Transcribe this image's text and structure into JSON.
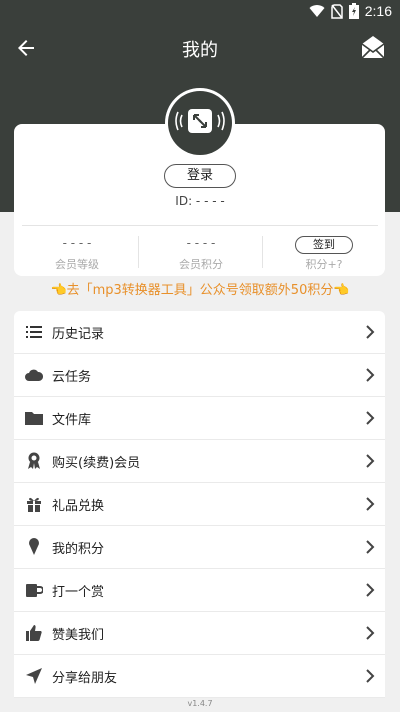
{
  "status_bar": {
    "time": "2:16"
  },
  "header": {
    "title": "我的"
  },
  "profile": {
    "login_label": "登录",
    "user_id": "ID: - - - -",
    "stats": [
      {
        "value": "- - - -",
        "label": "会员等级"
      },
      {
        "value": "- - - -",
        "label": "会员积分"
      }
    ],
    "checkin_label": "签到",
    "checkin_points": "积分+?"
  },
  "promo_text": "👈去「mp3转换器工具」公众号领取额外50积分👈",
  "menu": [
    {
      "label": "历史记录",
      "icon": "list-icon"
    },
    {
      "label": "云任务",
      "icon": "cloud-icon"
    },
    {
      "label": "文件库",
      "icon": "folder-icon"
    },
    {
      "label": "购买(续费)会员",
      "icon": "award-icon"
    },
    {
      "label": "礼品兑换",
      "icon": "gift-icon"
    },
    {
      "label": "我的积分",
      "icon": "ice-cream-icon"
    },
    {
      "label": "打一个赏",
      "icon": "mug-icon"
    },
    {
      "label": "赞美我们",
      "icon": "thumbs-up-icon"
    },
    {
      "label": "分享给朋友",
      "icon": "send-icon"
    }
  ],
  "version": "v1.4.7",
  "colors": {
    "header_bg": "#3a3f3b",
    "promo": "#e8902a",
    "page_bg": "#f0f0f0"
  }
}
